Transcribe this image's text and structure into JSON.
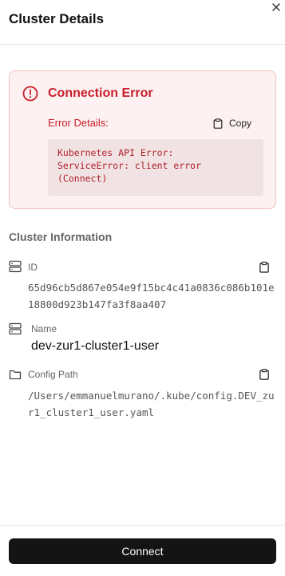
{
  "header": {
    "title": "Cluster Details"
  },
  "error": {
    "title": "Connection Error",
    "details_label": "Error Details:",
    "copy_label": "Copy",
    "message": "Kubernetes API Error:\nServiceError: client error\n(Connect)"
  },
  "section": {
    "title": "Cluster Information"
  },
  "fields": {
    "id": {
      "label": "ID",
      "value": "65d96cb5d867e054e9f15bc4c41a0836c086b101e18800d923b147fa3f8aa407"
    },
    "name": {
      "label": "Name",
      "value": "dev-zur1-cluster1-user"
    },
    "config_path": {
      "label": "Config Path",
      "value": "/Users/emmanuelmurano/.kube/config.DEV_zur1_cluster1_user.yaml"
    }
  },
  "footer": {
    "connect_label": "Connect"
  },
  "colors": {
    "error": "#c81e2a",
    "error_bg": "#fdf1f1",
    "primary_button": "#141414"
  }
}
